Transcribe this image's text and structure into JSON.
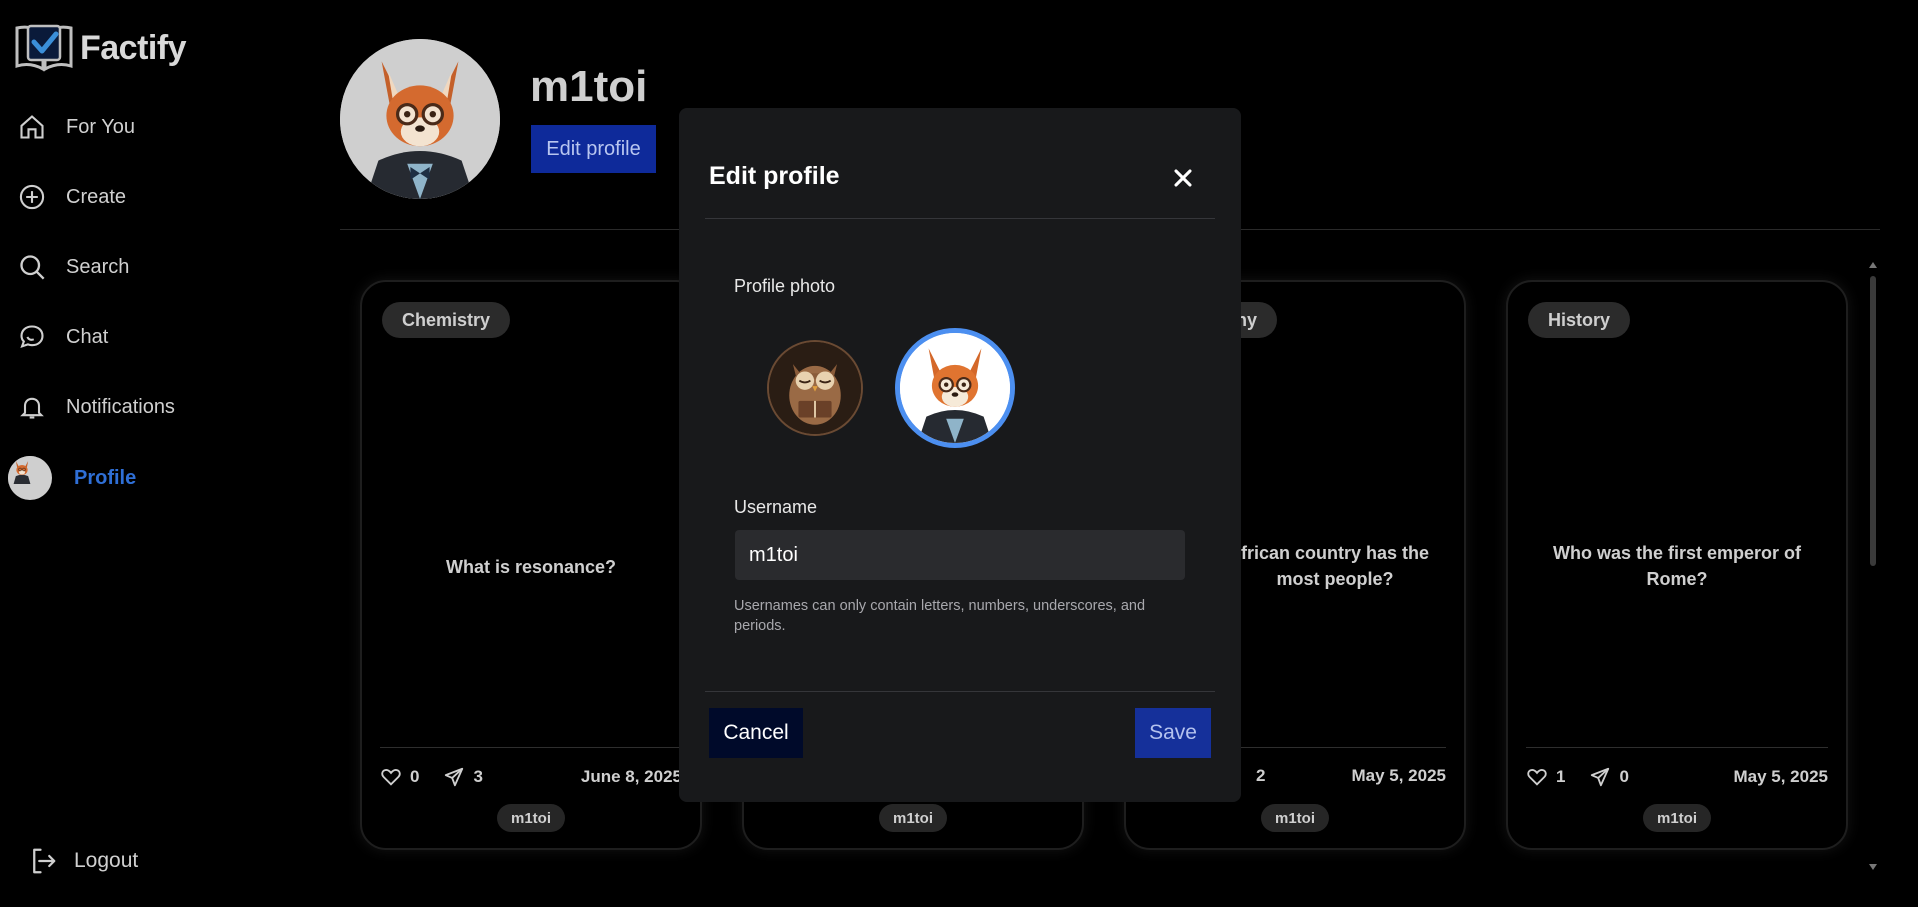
{
  "app": {
    "name": "Factify"
  },
  "sidebar": {
    "items": [
      {
        "label": "For You",
        "icon": "home-icon"
      },
      {
        "label": "Create",
        "icon": "plus-circle-icon"
      },
      {
        "label": "Search",
        "icon": "search-icon"
      },
      {
        "label": "Chat",
        "icon": "chat-icon"
      },
      {
        "label": "Notifications",
        "icon": "bell-icon"
      },
      {
        "label": "Profile",
        "icon": "avatar",
        "active": true
      }
    ],
    "logout_label": "Logout"
  },
  "profile": {
    "username": "m1toi",
    "edit_button_label": "Edit profile"
  },
  "cards": [
    {
      "tag": "Chemistry",
      "question": "What is resonance?",
      "likes": "0",
      "shares": "3",
      "date": "June 8, 2025",
      "author": "m1toi"
    },
    {
      "tag": "",
      "question": "",
      "likes": "",
      "shares": "",
      "date": "",
      "author": "m1toi"
    },
    {
      "tag": "ny",
      "question": "frican country has the most people?",
      "likes": "",
      "shares": "2",
      "date": "May 5, 2025",
      "author": "m1toi"
    },
    {
      "tag": "History",
      "question": "Who was the first emperor of Rome?",
      "likes": "1",
      "shares": "0",
      "date": "May 5, 2025",
      "author": "m1toi"
    }
  ],
  "modal": {
    "title": "Edit profile",
    "photo_label": "Profile photo",
    "username_label": "Username",
    "username_value": "m1toi",
    "helper_text": "Usernames can only contain letters, numbers, underscores, and periods.",
    "cancel_label": "Cancel",
    "save_label": "Save"
  },
  "colors": {
    "accent_blue": "#0e2a9a",
    "active_nav": "#2f6fd6",
    "selected_ring": "#4c8ff0",
    "modal_bg": "#18191b"
  }
}
